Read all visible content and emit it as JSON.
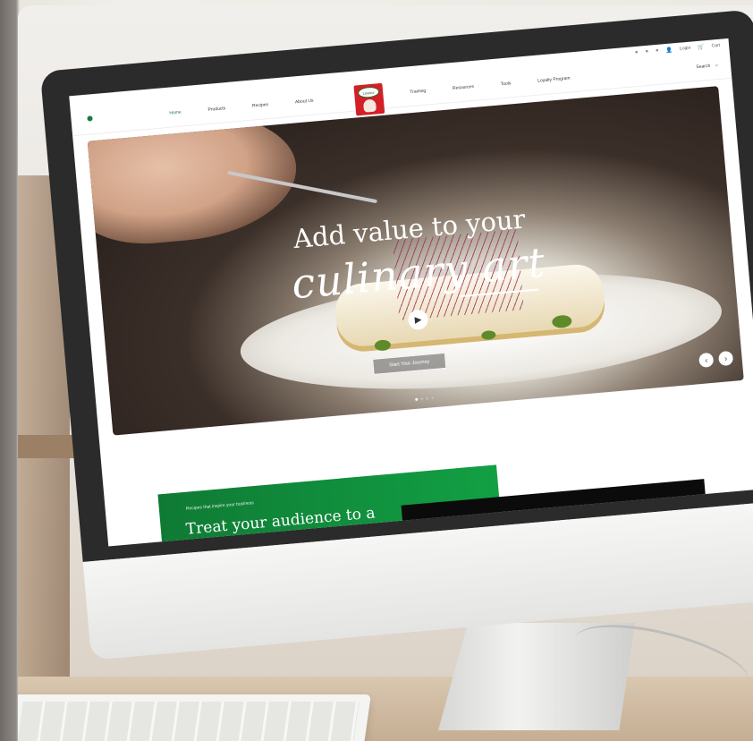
{
  "topbar": {
    "login": "Login",
    "cart": "Cart"
  },
  "nav": {
    "left": [
      "Home",
      "Products",
      "Recipes",
      "About Us"
    ],
    "right": [
      "Training",
      "Resources",
      "Tools",
      "Loyalty Program"
    ],
    "search": "Search"
  },
  "logo": {
    "brand": "Lesieur"
  },
  "hero": {
    "title_line1": "Add value to your",
    "title_line2": "culinary art",
    "cta": "Start Your Journey"
  },
  "promo": {
    "kicker": "Recipes that inspire your business",
    "title": "Treat your audience to a"
  },
  "colors": {
    "brand_red": "#d32027",
    "brand_green": "#0f7a34"
  },
  "icons": [
    "play-icon",
    "chevron-left-icon",
    "chevron-right-icon",
    "search-icon",
    "cart-icon",
    "user-icon"
  ]
}
